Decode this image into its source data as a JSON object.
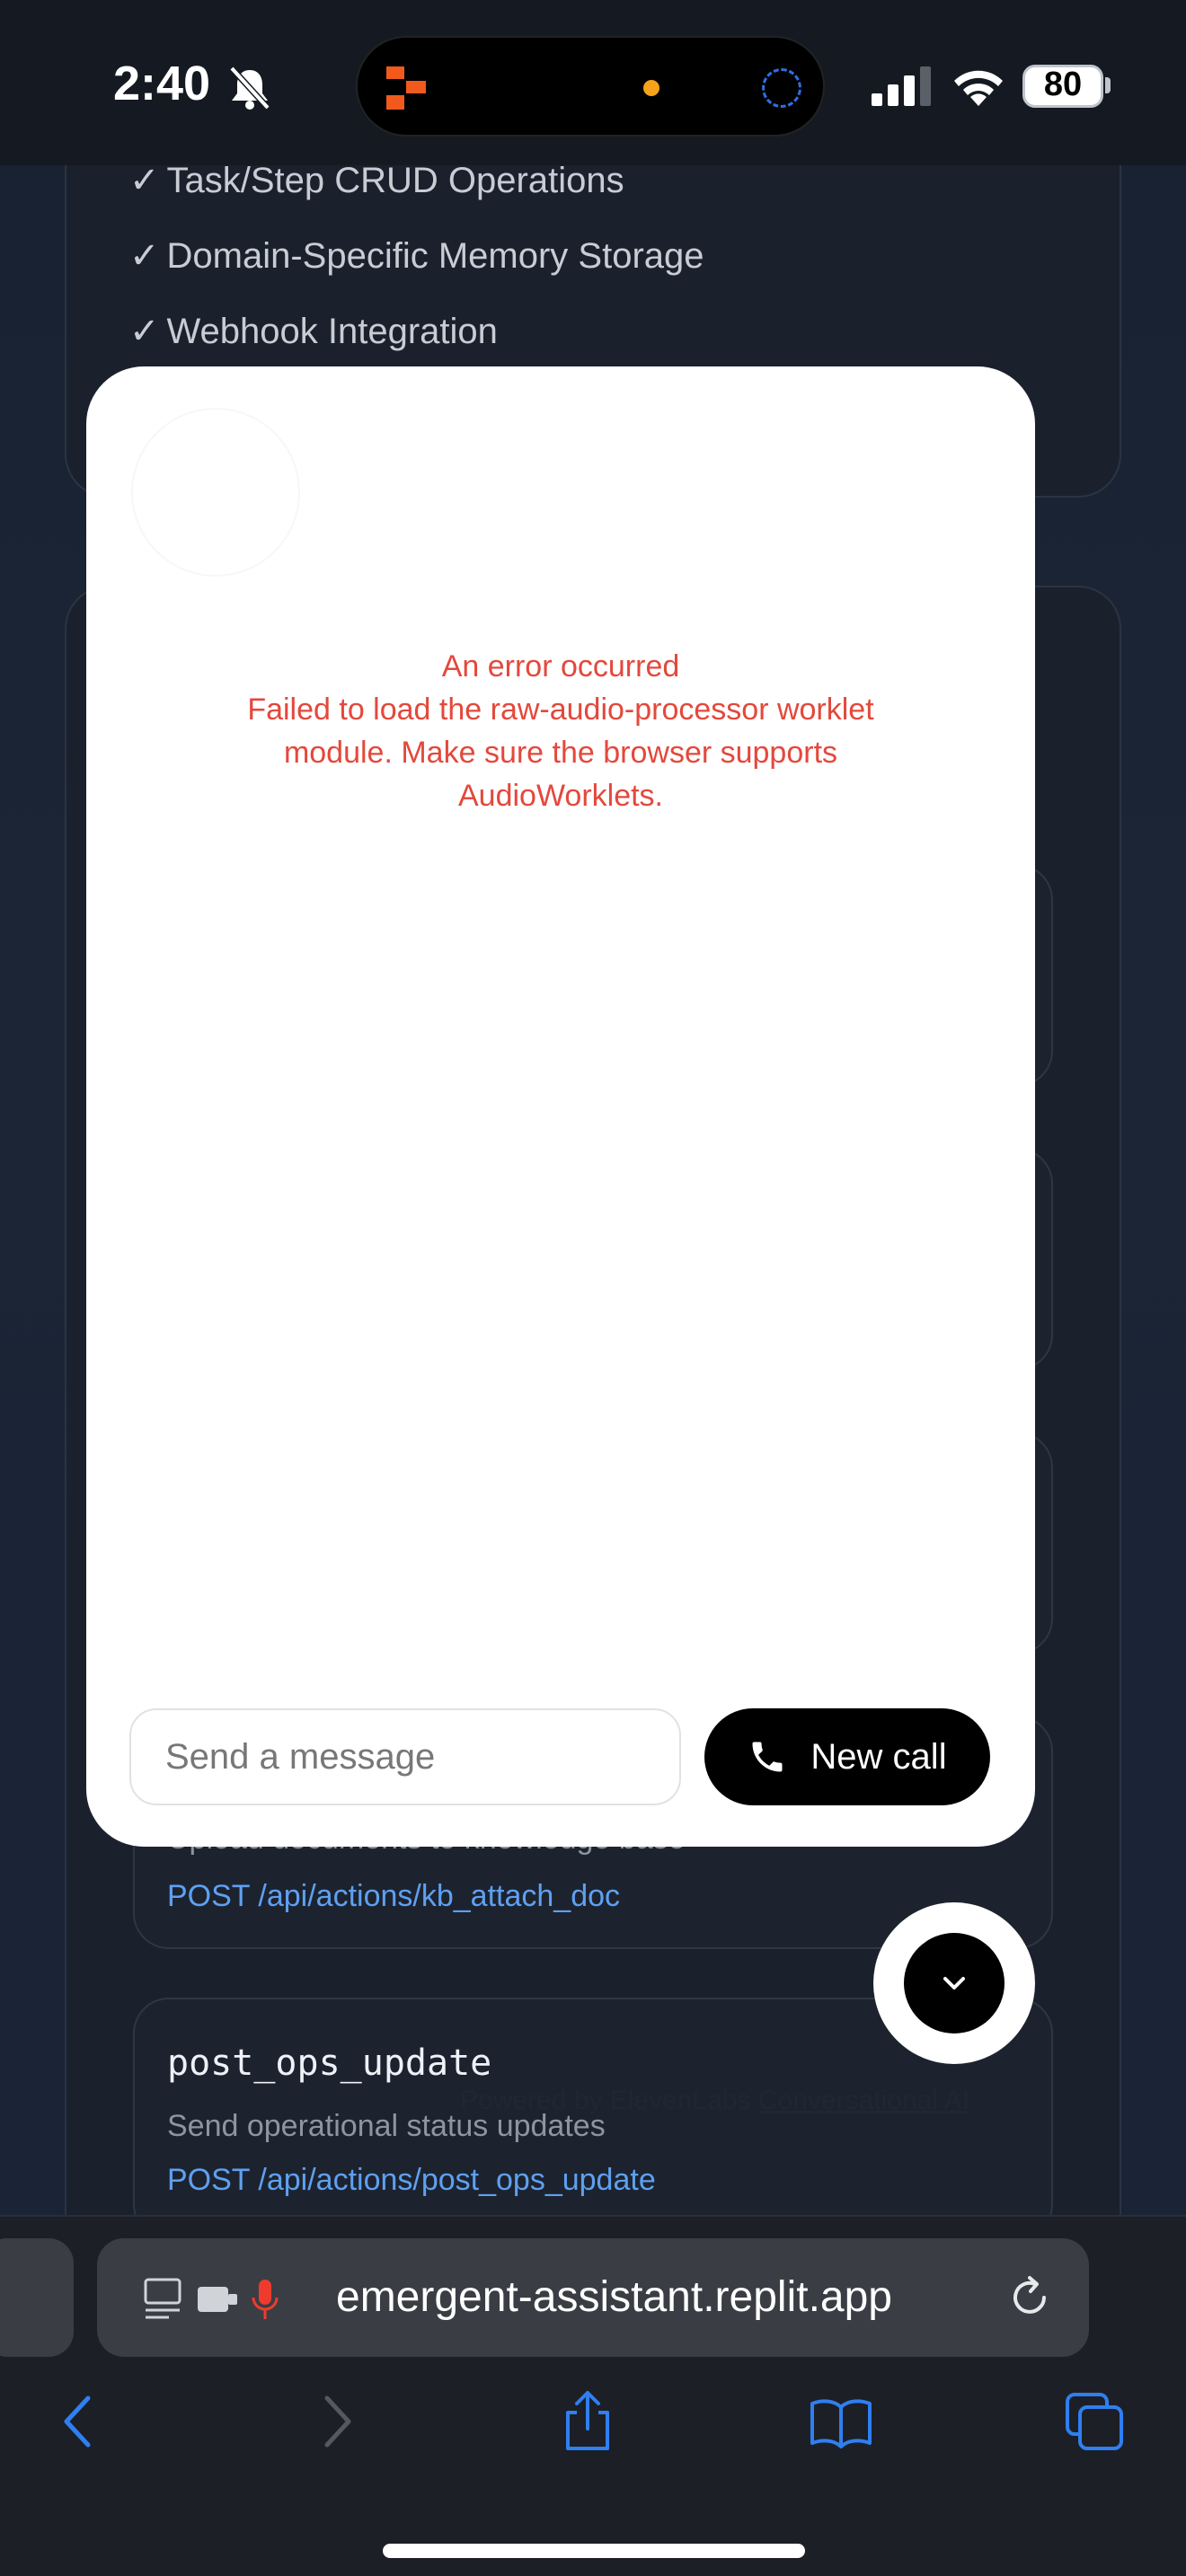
{
  "status_bar": {
    "time": "2:40",
    "battery": "80",
    "icons": [
      "bell-slash-icon",
      "signal-icon",
      "wifi-icon",
      "battery-icon"
    ]
  },
  "background": {
    "features": [
      "Task/Step CRUD Operations",
      "Domain-Specific Memory Storage",
      "Webhook Integration"
    ],
    "check_mark": "✓",
    "actions": [
      {
        "desc": "Upload documents to knowledge base",
        "endpoint": "POST /api/actions/kb_attach_doc"
      },
      {
        "name": "post_ops_update",
        "desc": "Send operational status updates",
        "endpoint": "POST /api/actions/post_ops_update"
      }
    ],
    "powered_by": "Powered by ElevenLabs",
    "powered_link": "Conversational AI"
  },
  "modal": {
    "error_title": "An error occurred",
    "error_message": "Failed to load the raw-audio-processor worklet module. Make sure the browser supports AudioWorklets.",
    "input_placeholder": "Send a message",
    "new_call_label": "New call",
    "colors": {
      "error": "#e4483c",
      "button": "#000000"
    }
  },
  "browser": {
    "url": "emergent-assistant.replit.app",
    "toolbar": [
      "back-icon",
      "forward-icon",
      "share-icon",
      "bookmarks-icon",
      "tabs-icon"
    ]
  }
}
